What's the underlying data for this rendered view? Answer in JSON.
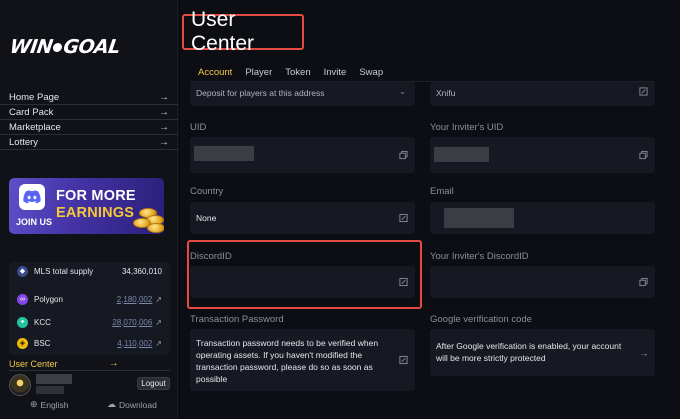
{
  "sidebar": {
    "logo": "WinGoal",
    "nav": [
      {
        "label": "Home Page"
      },
      {
        "label": "Card Pack"
      },
      {
        "label": "Marketplace"
      },
      {
        "label": "Lottery"
      }
    ],
    "banner": {
      "line1": "FOR MORE",
      "line2": "EARNINGS",
      "join": "JOIN US"
    },
    "tokens": {
      "supply_label": "MLS total supply",
      "supply_value": "34,360,010",
      "chains": [
        {
          "name": "Polygon",
          "value": "2,180,002",
          "color": "#8247e5"
        },
        {
          "name": "KCC",
          "value": "28,070,006",
          "color": "#23c29e"
        },
        {
          "name": "BSC",
          "value": "4,110,002",
          "color": "#f0b90b"
        }
      ]
    },
    "user_center": "User Center",
    "logout": "Logout",
    "language": "English",
    "download": "Download"
  },
  "main": {
    "title": "User Center",
    "tabs": [
      "Account",
      "Player",
      "Token",
      "Invite",
      "Swap"
    ],
    "active_tab": "Account",
    "top_left_value": "Deposit for players at this address",
    "top_right_value": "Xnifu",
    "fields": {
      "uid": {
        "label": "UID"
      },
      "inviter_uid": {
        "label": "Your Inviter's UID"
      },
      "country": {
        "label": "Country",
        "value": "None"
      },
      "email": {
        "label": "Email"
      },
      "discord": {
        "label": "DiscordID",
        "value": ""
      },
      "inviter_discord": {
        "label": "Your Inviter's DiscordID",
        "value": ""
      },
      "tx_password": {
        "label": "Transaction Password",
        "value": "Transaction password needs to be verified when operating assets. If you haven't modified the transaction password, please do so as soon as possible"
      },
      "google": {
        "label": "Google verification code",
        "value": "After Google verification is enabled, your account will be more strictly protected"
      }
    }
  },
  "colors": {
    "accent": "#f2c84b",
    "highlight": "#e34b43",
    "panel": "#161922"
  }
}
